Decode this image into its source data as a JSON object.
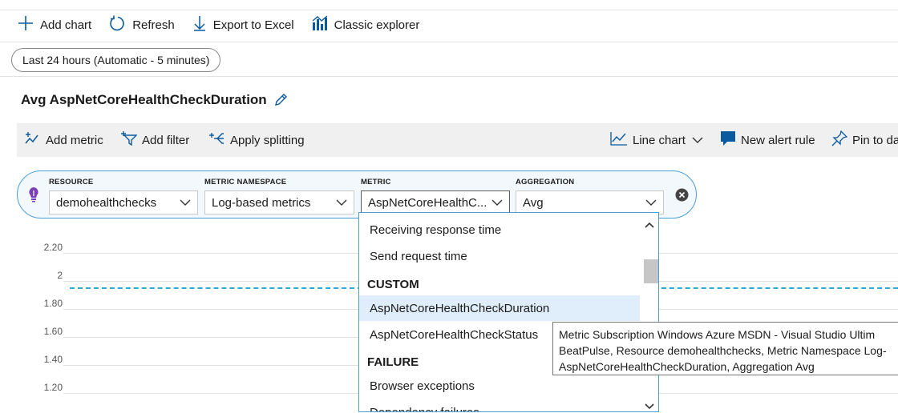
{
  "toolbar": {
    "add_chart": "Add chart",
    "refresh": "Refresh",
    "export": "Export to Excel",
    "classic": "Classic explorer"
  },
  "time_range": "Last 24 hours (Automatic - 5 minutes)",
  "chart_title": "Avg AspNetCoreHealthCheckDuration",
  "command_bar": {
    "add_metric": "Add metric",
    "add_filter": "Add filter",
    "apply_splitting": "Apply splitting",
    "chart_type": "Line chart",
    "new_alert": "New alert rule",
    "pin": "Pin to da"
  },
  "selector": {
    "resource_label": "RESOURCE",
    "resource_value": "demohealthchecks",
    "namespace_label": "METRIC NAMESPACE",
    "namespace_value": "Log-based metrics",
    "metric_label": "METRIC",
    "metric_value": "AspNetCoreHealthC...",
    "aggregation_label": "AGGREGATION",
    "aggregation_value": "Avg"
  },
  "dropdown": {
    "items": [
      "Receiving response time",
      "Send request time"
    ],
    "custom_header": "CUSTOM",
    "custom_items": [
      "AspNetCoreHealthCheckDuration",
      "AspNetCoreHealthCheckStatus"
    ],
    "failure_header": "FAILURE",
    "failure_items": [
      "Browser exceptions",
      "Dependency failures"
    ]
  },
  "tooltip": {
    "line1": "Metric Subscription Windows Azure MSDN - Visual Studio Ultim",
    "line2": "BeatPulse, Resource demohealthchecks, Metric Namespace Log-",
    "line3": "AspNetCoreHealthCheckDuration, Aggregation Avg"
  },
  "chart_data": {
    "type": "line",
    "y_ticks": [
      "2.20",
      "2",
      "1.80",
      "1.60",
      "1.40",
      "1.20"
    ],
    "series": [
      {
        "values": [
          1.95,
          1.95
        ]
      }
    ],
    "ylim": [
      1.1,
      2.25
    ],
    "series_color": "#2ea7e0"
  }
}
